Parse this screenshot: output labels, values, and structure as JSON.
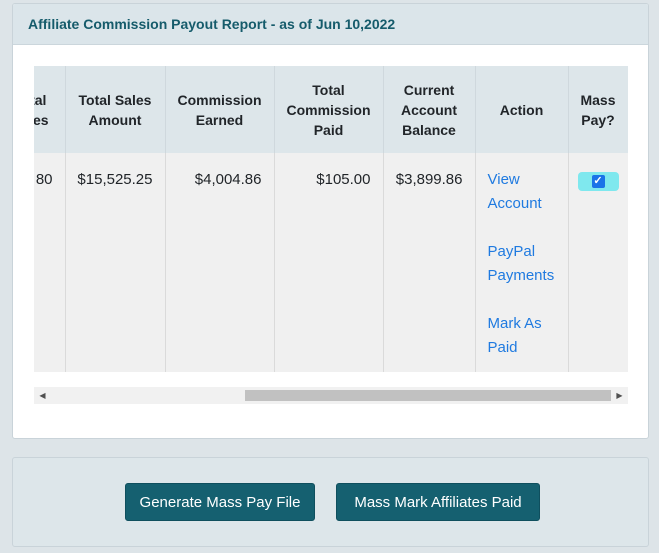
{
  "report": {
    "title": "Affiliate Commission Payout Report - as of Jun 10,2022"
  },
  "table": {
    "columns": [
      "Total Sales",
      "Total Sales Amount",
      "Commission Earned",
      "Total Commission Paid",
      "Current Account Balance",
      "Action",
      "Mass Pay?"
    ],
    "rows": [
      {
        "total_sales": "80",
        "total_sales_amount": "$15,525.25",
        "commission_earned": "$4,004.86",
        "total_commission_paid": "$105.00",
        "current_account_balance": "$3,899.86",
        "actions": [
          "View Account",
          "PayPal Payments",
          "Mark As Paid"
        ],
        "mass_pay_checked": true
      }
    ]
  },
  "scrollbar": {
    "left_arrow": "◀",
    "right_arrow": "▶",
    "position": 0.55
  },
  "footer": {
    "generate_button": "Generate Mass Pay File",
    "mark_paid_button": "Mass Mark Affiliates Paid"
  },
  "colors": {
    "header_text": "#155b6b",
    "link": "#1f7ae0",
    "button_bg": "#156070",
    "checkbox": "#1a73e8"
  }
}
